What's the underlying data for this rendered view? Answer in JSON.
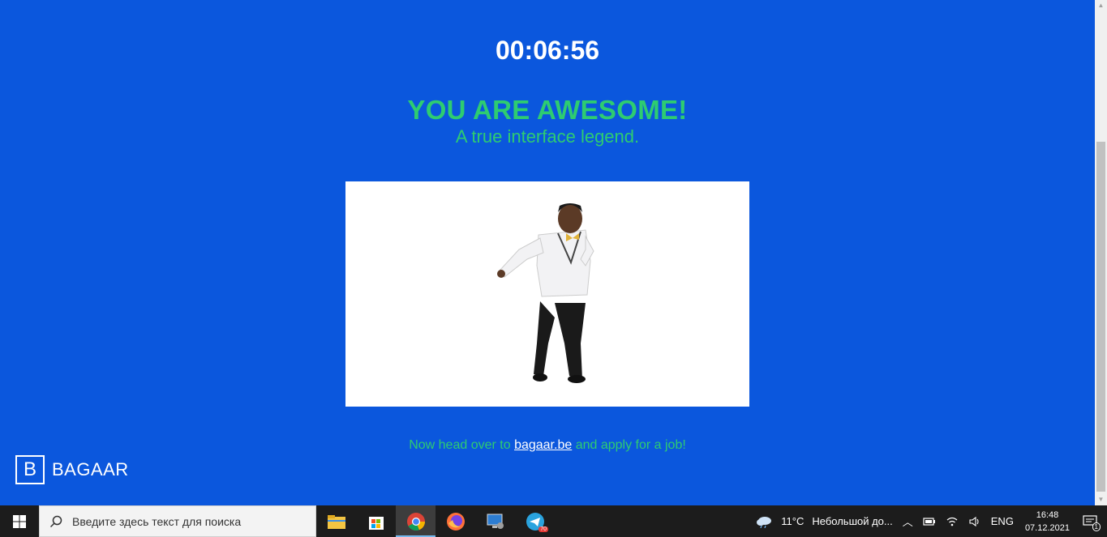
{
  "timer": "00:06:56",
  "headline": "YOU ARE AWESOME!",
  "subline": "A true interface legend.",
  "footer": {
    "prefix": "Now head over to ",
    "link_text": "bagaar.be",
    "suffix": " and apply for a job!"
  },
  "brand": {
    "letter": "B",
    "name": "BAGAAR"
  },
  "colors": {
    "background": "#0b57dd",
    "accent": "#2ecc71",
    "taskbar": "#1c1c1c"
  },
  "taskbar": {
    "search_placeholder": "Введите здесь текст для поиска",
    "apps": [
      {
        "name": "file-explorer-icon"
      },
      {
        "name": "store-icon"
      },
      {
        "name": "chrome-icon",
        "active": true
      },
      {
        "name": "firefox-icon"
      },
      {
        "name": "remote-desktop-icon"
      },
      {
        "name": "telegram-icon",
        "badge": "70"
      }
    ],
    "weather": {
      "temp": "11°C",
      "text": "Небольшой до..."
    },
    "language": "ENG",
    "time": "16:48",
    "date": "07.12.2021",
    "notifications": "1"
  }
}
